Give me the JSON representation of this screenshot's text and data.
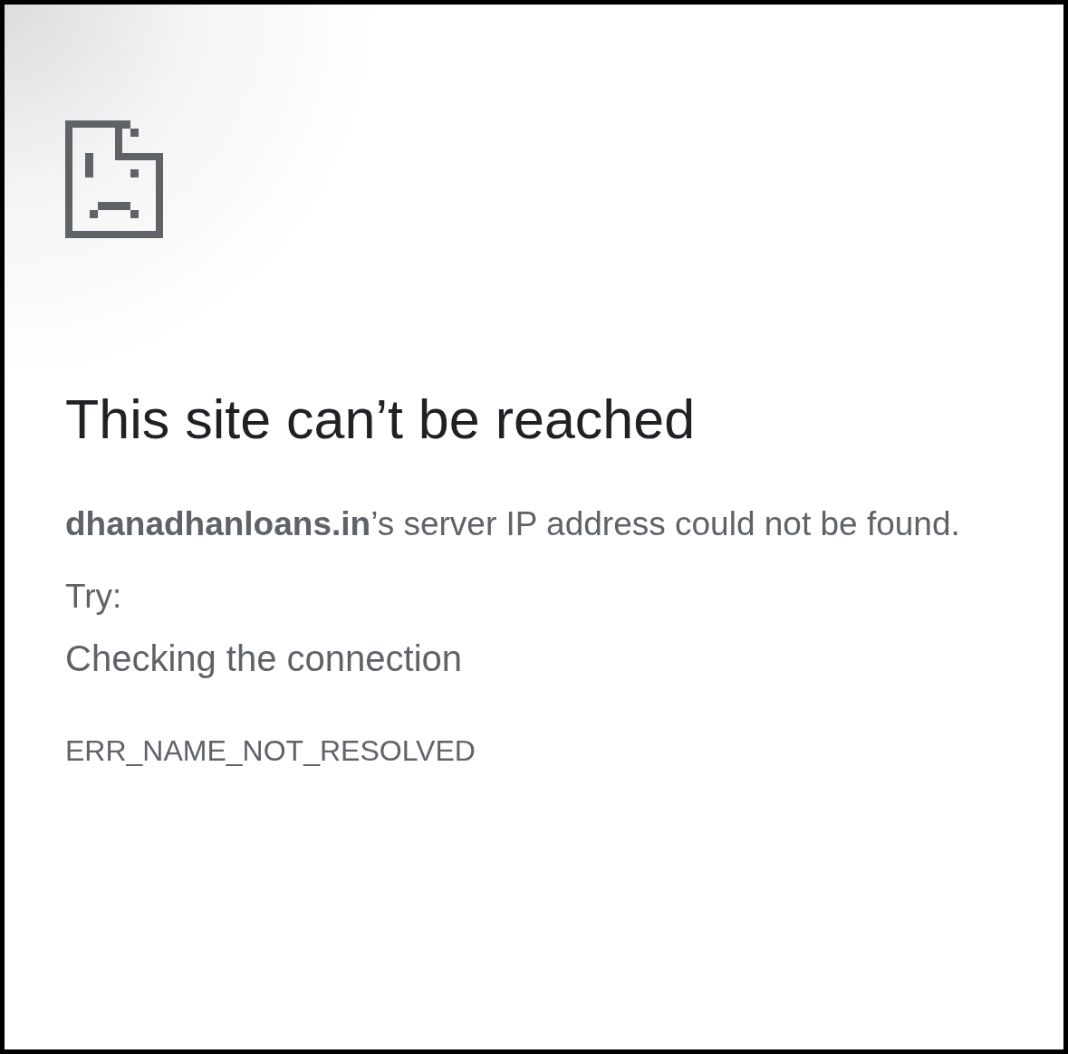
{
  "heading": "This site can’t be reached",
  "message": "**dhanadhanloans.in**’s server IP address could not be found.",
  "try_label": "Try:",
  "suggestions": [
    "Checking the connection"
  ],
  "error_code": "ERR_NAME_NOT_RESOLVED"
}
